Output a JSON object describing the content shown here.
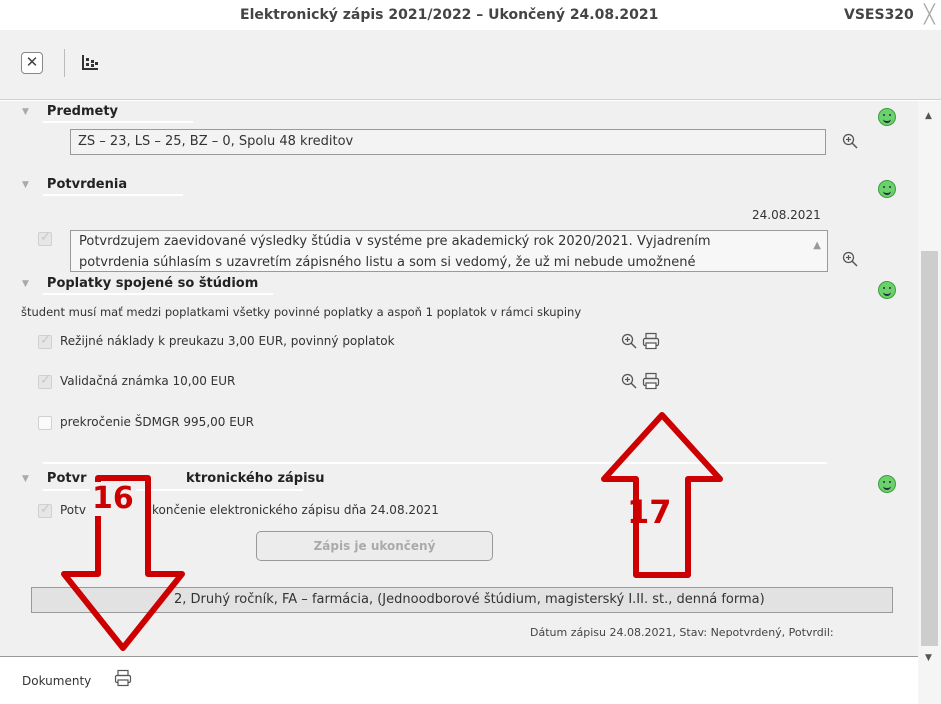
{
  "window": {
    "title": "Elektronický zápis 2021/2022 – Ukončený 24.08.2021",
    "code": "VSES320",
    "close_glyph": "╳"
  },
  "toolbar": {
    "close_label": "✕"
  },
  "sections": {
    "predmety": {
      "title": "Predmety",
      "field": "ZS – 23, LS – 25, BZ – 0, Spolu 48 kreditov"
    },
    "potvrdenia": {
      "title": "Potvrdenia",
      "date": "24.08.2021",
      "text_line1": "Potvrdzujem zaevidované výsledky štúdia v systéme pre akademický rok 2020/2021. Vyjadrením",
      "text_line2": "potvrdenia súhlasím s uzavretím zápisného listu a som si vedomý, že už mi nebude umožnené"
    },
    "poplatky": {
      "title": "Poplatky spojené so štúdiom",
      "note": "študent musí mať medzi poplatkami všetky povinné poplatky a aspoň 1 poplatok v rámci skupiny",
      "items": [
        {
          "label": "Režijné náklady k preukazu 3,00 EUR, povinný poplatok",
          "checked": true
        },
        {
          "label": "Validačná známka 10,00 EUR",
          "checked": true
        },
        {
          "label": "prekročenie ŠDMGR 995,00 EUR",
          "checked": false
        }
      ]
    },
    "ukoncenie": {
      "title_left": "Potvr",
      "title_right": "ktronického zápisu",
      "check_left": "Potv",
      "check_right": "končenie elektronického zápisu dňa 24.08.2021",
      "button": "Zápis je ukončený"
    }
  },
  "info_bar": "2, Druhý ročník, FA – farmácia, (Jednoodborové štúdium, magisterský I.II. st., denná forma)",
  "date_line": "Dátum zápisu 24.08.2021, Stav: Nepotvrdený, Potvrdil:",
  "bottom": {
    "label": "Dokumenty"
  },
  "callouts": {
    "left": "16",
    "right": "17"
  },
  "colors": {
    "smiley": "#6bd16b",
    "arrow": "#cc0000"
  }
}
